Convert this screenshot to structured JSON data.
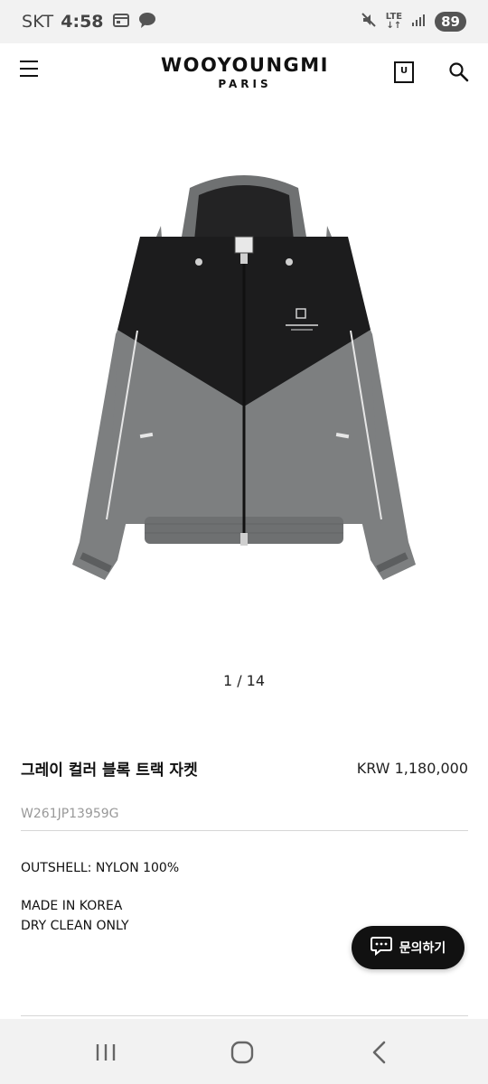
{
  "status_bar": {
    "carrier": "SKT",
    "time": "4:58",
    "network": "LTE",
    "battery": "89"
  },
  "header": {
    "brand": "WOOYOUNGMI",
    "brand_sub": "PARIS",
    "bag_glyph": "U"
  },
  "gallery": {
    "pager": "1 / 14"
  },
  "product": {
    "name": "그레이 컬러 블록 트랙 자켓",
    "price": "KRW 1,180,000",
    "code": "W261JP13959G",
    "material": "OUTSHELL: NYLON 100%",
    "origin": "MADE IN KOREA",
    "care": "DRY CLEAN ONLY"
  },
  "inquiry": {
    "label": "문의하기"
  },
  "icons": {
    "menu": "hamburger-menu-icon",
    "bag": "shopping-bag-icon",
    "search": "search-icon",
    "chat": "chat-bubble-icon"
  },
  "colors": {
    "accent": "#111111",
    "jacket_gray": "#7d7f80",
    "jacket_black": "#1c1c1d",
    "system_bar": "#f2f2f2"
  }
}
